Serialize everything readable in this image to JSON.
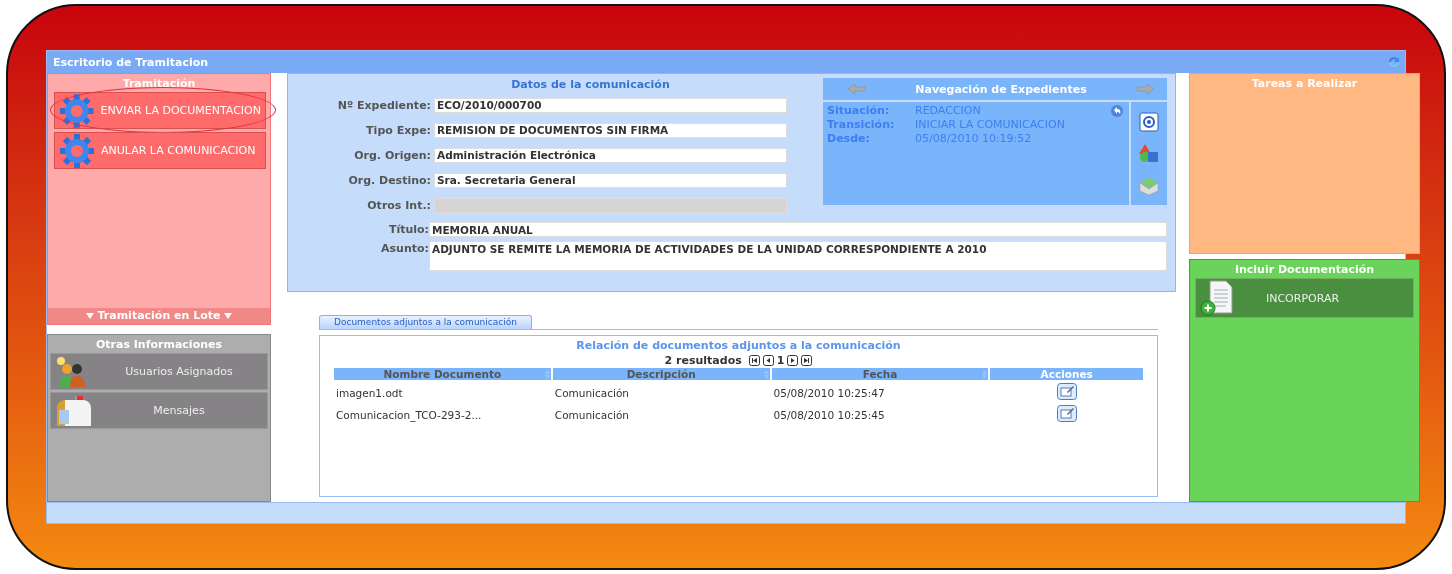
{
  "window": {
    "title": "Escritorio de Tramitacion"
  },
  "tramitacion": {
    "title": "Tramitación",
    "actions": [
      {
        "label": "ENVIAR LA DOCUMENTACION",
        "circled": true
      },
      {
        "label": "ANULAR LA COMUNICACION",
        "circled": false
      }
    ],
    "footer": "Tramitación en Lote"
  },
  "otras": {
    "title": "Otras Informaciones",
    "items": [
      {
        "label": "Usuarios Asignados",
        "kind": "users"
      },
      {
        "label": "Mensajes",
        "kind": "mailbox"
      }
    ]
  },
  "datos": {
    "title": "Datos de la comunicación",
    "fields": [
      {
        "label": "Nº Expediente:",
        "value": "ECO/2010/000700",
        "disabled": false
      },
      {
        "label": "Tipo Expe:",
        "value": "REMISION DE DOCUMENTOS SIN FIRMA",
        "disabled": false
      },
      {
        "label": "Org. Origen:",
        "value": "Administración Electrónica",
        "disabled": false
      },
      {
        "label": "Org. Destino:",
        "value": "Sra. Secretaria General",
        "disabled": false
      },
      {
        "label": "Otros Int.:",
        "disabled": true
      }
    ],
    "wide_fields": [
      {
        "label": "Título:",
        "value": "MEMORIA ANUAL",
        "kind": "line"
      },
      {
        "label": "Asunto:",
        "value": "ADJUNTO SE REMITE LA MEMORIA DE ACTIVIDADES DE LA UNIDAD CORRESPONDIENTE A 2010",
        "kind": "area"
      }
    ]
  },
  "navegacion": {
    "title": "Navegación de Expedientes",
    "info": [
      {
        "label": "Situación:",
        "value": "REDACCION"
      },
      {
        "label": "Transición:",
        "value": "INICIAR LA COMUNICACION"
      },
      {
        "label": "Desde:",
        "value": "05/08/2010 10:19:52"
      }
    ]
  },
  "documentos": {
    "tab": "Documentos adjuntos a la comunicación",
    "heading": "Relación de documentos adjuntos a la comunicación",
    "count": "2 resultados",
    "page": "1",
    "columns": [
      "Nombre Documento",
      "Descripción",
      "Fecha",
      "Acciones"
    ],
    "rows": [
      [
        "imagen1.odt",
        "Comunicación",
        "05/08/2010 10:25:47"
      ],
      [
        "Comunicacion_TCO-293-2...",
        "Comunicación",
        "05/08/2010 10:25:45"
      ]
    ]
  },
  "tareas": {
    "title": "Tareas a Realizar"
  },
  "incluir": {
    "title": "Incluir Documentación",
    "button": "INCORPORAR"
  }
}
